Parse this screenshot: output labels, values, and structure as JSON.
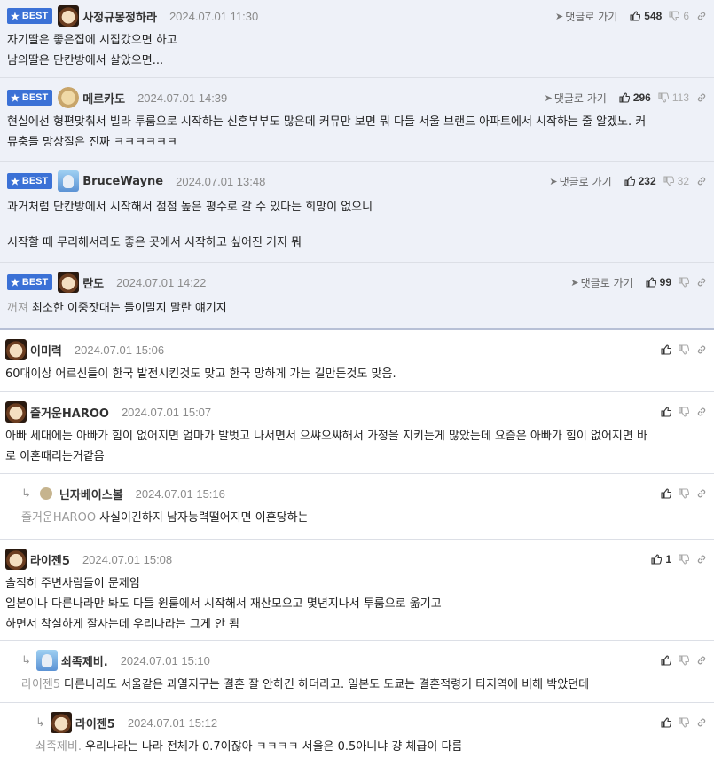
{
  "labels": {
    "best": "BEST",
    "reply": "댓글로 가기"
  },
  "comments": [
    {
      "nick": "사정규몽정하라",
      "date": "2024.07.01 11:30",
      "up": "548",
      "down": "6",
      "lines": [
        "자기딸은 좋은집에 시집갔으면 하고",
        "남의딸은 단칸방에서 살았으면..."
      ]
    },
    {
      "nick": "메르카도",
      "date": "2024.07.01 14:39",
      "up": "296",
      "down": "113",
      "lines": [
        "현실에선 형편맞춰서 빌라 투룸으로 시작하는 신혼부부도 많은데 커뮤만 보면 뭐 다들 서울 브랜드 아파트에서 시작하는 줄 알겠노. 커",
        "뮤충들 망상질은 진짜 ㅋㅋㅋㅋㅋㅋ"
      ]
    },
    {
      "nick": "BruceWayne",
      "date": "2024.07.01 13:48",
      "up": "232",
      "down": "32",
      "lines": [
        "과거처럼 단칸방에서 시작해서 점점 높은 평수로 갈 수 있다는 희망이 없으니",
        "",
        "시작할 때 무리해서라도 좋은 곳에서 시작하고 싶어진 거지 뭐"
      ]
    },
    {
      "nick": "란도",
      "date": "2024.07.01 14:22",
      "up": "99",
      "to": "꺼져",
      "lines": [
        "최소한 이중잣대는 들이밀지 말란 얘기지"
      ]
    },
    {
      "nick": "이미력",
      "date": "2024.07.01 15:06",
      "lines": [
        "60대이상 어르신들이 한국 발전시킨것도 맞고 한국 망하게 가는 길만든것도 맞음."
      ]
    },
    {
      "nick": "즐거운HAROO",
      "date": "2024.07.01 15:07",
      "lines": [
        "아빠 세대에는 아빠가 힘이 없어지면 엄마가 발벗고 나서면서 으쌰으쌰해서 가정을 지키는게 많았는데 요즘은 아빠가 힘이 없어지면 바",
        "로 이혼때리는거같음"
      ]
    },
    {
      "nick": "닌자베이스볼",
      "date": "2024.07.01 15:16",
      "to": "즐거운HAROO",
      "lines": [
        "사실이긴하지 남자능력떨어지면 이혼당하는"
      ]
    },
    {
      "nick": "라이젠5",
      "date": "2024.07.01 15:08",
      "up": "1",
      "lines": [
        "솔직히 주변사람들이 문제임",
        "일본이나 다른나라만 봐도 다들 원룸에서 시작해서 재산모으고 몇년지나서 투룸으로 옮기고",
        "하면서 착실하게 잘사는데 우리나라는 그게 안 됨"
      ]
    },
    {
      "nick": "쇠족제비.",
      "date": "2024.07.01 15:10",
      "to": "라이젠5",
      "lines": [
        "다른나라도 서울같은 과열지구는 결혼 잘 안하긴 하더라고. 일본도 도쿄는 결혼적령기 타지역에 비해 박았던데"
      ]
    },
    {
      "nick": "라이젠5",
      "date": "2024.07.01 15:12",
      "to": "쇠족제비.",
      "lines": [
        "우리나라는 나라 전체가 0.7이잖아 ㅋㅋㅋㅋ 서울은 0.5아니냐 걍 체급이 다름"
      ]
    }
  ],
  "colors": {
    "best_badge": "#3b71d6",
    "best_bg": "#eef1f8"
  }
}
